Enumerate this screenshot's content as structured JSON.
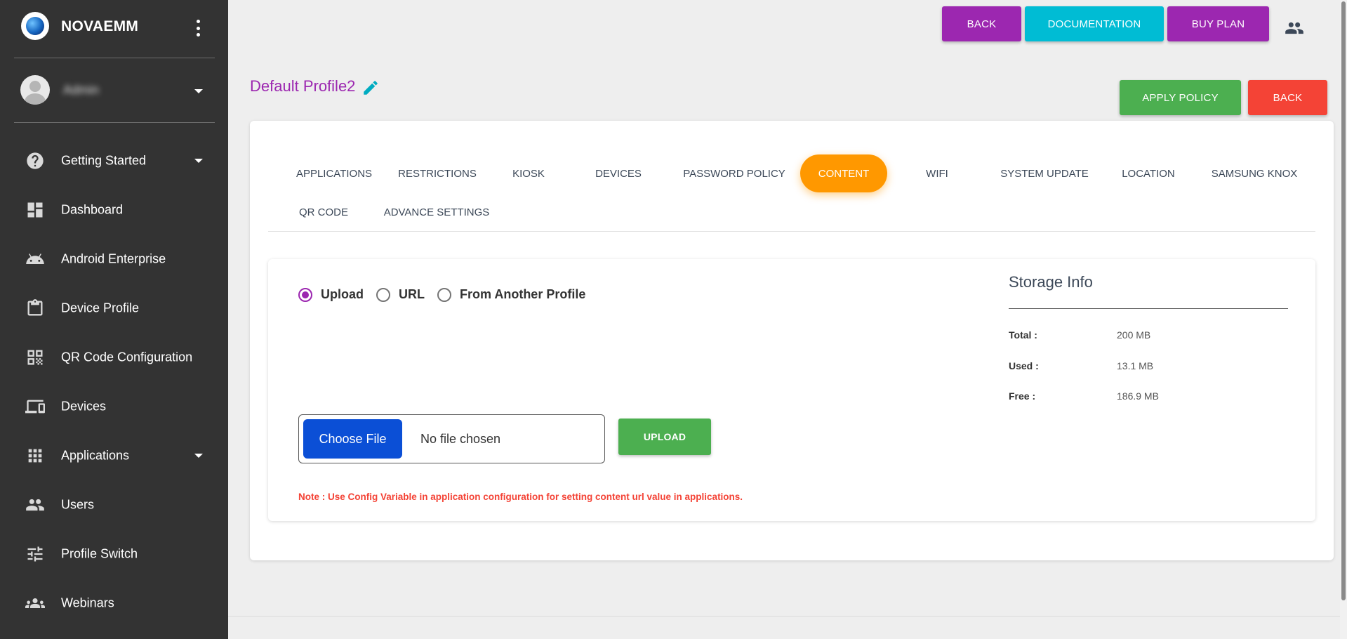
{
  "brand": {
    "name": "NOVAEMM"
  },
  "user": {
    "name": "Admin"
  },
  "sidebar": {
    "items": [
      {
        "label": "Getting Started",
        "icon": "help-circle-icon",
        "has_caret": true
      },
      {
        "label": "Dashboard",
        "icon": "dashboard-icon",
        "has_caret": false
      },
      {
        "label": "Android Enterprise",
        "icon": "android-icon",
        "has_caret": false
      },
      {
        "label": "Device Profile",
        "icon": "clipboard-icon",
        "has_caret": false
      },
      {
        "label": "QR Code Configuration",
        "icon": "qr-code-icon",
        "has_caret": false
      },
      {
        "label": "Devices",
        "icon": "devices-icon",
        "has_caret": false
      },
      {
        "label": "Applications",
        "icon": "apps-grid-icon",
        "has_caret": true
      },
      {
        "label": "Users",
        "icon": "people-icon",
        "has_caret": false
      },
      {
        "label": "Profile Switch",
        "icon": "tune-icon",
        "has_caret": false
      },
      {
        "label": "Webinars",
        "icon": "groups-icon",
        "has_caret": false
      }
    ]
  },
  "header": {
    "back_label": "BACK",
    "documentation_label": "DOCUMENTATION",
    "buy_plan_label": "BUY PLAN"
  },
  "page": {
    "title": "Default Profile2",
    "apply_policy_label": "APPLY POLICY",
    "back_label": "BACK"
  },
  "tabs": [
    {
      "label": "APPLICATIONS",
      "active": false
    },
    {
      "label": "RESTRICTIONS",
      "active": false
    },
    {
      "label": "KIOSK",
      "active": false
    },
    {
      "label": "DEVICES",
      "active": false
    },
    {
      "label": "PASSWORD POLICY",
      "active": false
    },
    {
      "label": "CONTENT",
      "active": true
    },
    {
      "label": "WIFI",
      "active": false
    },
    {
      "label": "SYSTEM UPDATE",
      "active": false
    },
    {
      "label": "LOCATION",
      "active": false
    },
    {
      "label": "SAMSUNG KNOX",
      "active": false
    },
    {
      "label": "QR CODE",
      "active": false
    },
    {
      "label": "ADVANCE SETTINGS",
      "active": false
    }
  ],
  "content": {
    "source_options": [
      {
        "label": "Upload",
        "checked": true
      },
      {
        "label": "URL",
        "checked": false
      },
      {
        "label": "From Another Profile",
        "checked": false
      }
    ],
    "choose_file_label": "Choose File",
    "file_status": "No file chosen",
    "upload_label": "UPLOAD",
    "note": "Note : Use Config Variable in application configuration for setting content url value in applications."
  },
  "storage": {
    "title": "Storage Info",
    "rows": [
      {
        "key": "Total :",
        "value": "200 MB"
      },
      {
        "key": "Used :",
        "value": "13.1 MB"
      },
      {
        "key": "Free :",
        "value": "186.9 MB"
      }
    ]
  },
  "colors": {
    "sidebar_bg": "#333333",
    "accent_purple": "#9c27b0",
    "accent_cyan": "#00bcd4",
    "accent_green": "#4caf50",
    "accent_red": "#f44336",
    "active_tab": "#ff9800",
    "choose_file_blue": "#0b4fd6"
  }
}
